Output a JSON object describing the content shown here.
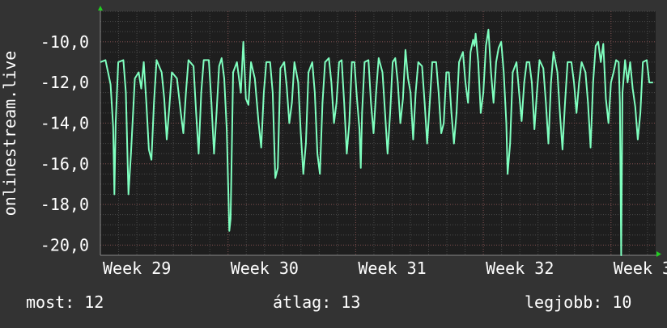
{
  "chart_data": {
    "type": "line",
    "ylabel": "onlinestream.live",
    "ylim": [
      -20.5,
      -8.5
    ],
    "yticks": [
      -10,
      -12,
      -14,
      -16,
      -18,
      -20
    ],
    "ytick_labels": [
      "-10,0",
      "-12,0",
      "-14,0",
      "-16,0",
      "-18,0",
      "-20,0"
    ],
    "xlim": [
      0,
      4.35
    ],
    "xticks": [
      0,
      1,
      2,
      3,
      4
    ],
    "xtick_labels": [
      "Week 29",
      "Week 30",
      "Week 31",
      "Week 32",
      "Week 3"
    ],
    "grid": true,
    "colors": {
      "background": "#333333",
      "plot": "#1e1e1e",
      "grid": "#5a5a5a",
      "line": "#7fffbf",
      "axis_arrow": "#22cc22",
      "text": "#ffffff"
    },
    "series": [
      {
        "values": [
          {
            "x": 0.0,
            "y": -11.0
          },
          {
            "x": 0.04,
            "y": -10.9
          },
          {
            "x": 0.06,
            "y": -11.5
          },
          {
            "x": 0.08,
            "y": -12.1
          },
          {
            "x": 0.1,
            "y": -14.2
          },
          {
            "x": 0.11,
            "y": -17.5
          },
          {
            "x": 0.12,
            "y": -14.0
          },
          {
            "x": 0.14,
            "y": -11.0
          },
          {
            "x": 0.18,
            "y": -10.9
          },
          {
            "x": 0.2,
            "y": -12.5
          },
          {
            "x": 0.22,
            "y": -17.5
          },
          {
            "x": 0.24,
            "y": -15.5
          },
          {
            "x": 0.27,
            "y": -11.8
          },
          {
            "x": 0.3,
            "y": -11.5
          },
          {
            "x": 0.32,
            "y": -12.3
          },
          {
            "x": 0.34,
            "y": -11.0
          },
          {
            "x": 0.36,
            "y": -13.0
          },
          {
            "x": 0.38,
            "y": -15.3
          },
          {
            "x": 0.4,
            "y": -15.8
          },
          {
            "x": 0.42,
            "y": -13.0
          },
          {
            "x": 0.44,
            "y": -10.9
          },
          {
            "x": 0.48,
            "y": -11.5
          },
          {
            "x": 0.5,
            "y": -12.8
          },
          {
            "x": 0.52,
            "y": -14.8
          },
          {
            "x": 0.54,
            "y": -13.2
          },
          {
            "x": 0.56,
            "y": -11.5
          },
          {
            "x": 0.6,
            "y": -11.8
          },
          {
            "x": 0.63,
            "y": -13.5
          },
          {
            "x": 0.65,
            "y": -14.5
          },
          {
            "x": 0.67,
            "y": -12.5
          },
          {
            "x": 0.69,
            "y": -10.9
          },
          {
            "x": 0.73,
            "y": -11.2
          },
          {
            "x": 0.75,
            "y": -13.5
          },
          {
            "x": 0.77,
            "y": -15.5
          },
          {
            "x": 0.79,
            "y": -12.5
          },
          {
            "x": 0.81,
            "y": -10.9
          },
          {
            "x": 0.85,
            "y": -10.9
          },
          {
            "x": 0.87,
            "y": -13.0
          },
          {
            "x": 0.89,
            "y": -15.5
          },
          {
            "x": 0.91,
            "y": -13.5
          },
          {
            "x": 0.93,
            "y": -11.2
          },
          {
            "x": 0.95,
            "y": -10.8
          },
          {
            "x": 0.97,
            "y": -11.8
          },
          {
            "x": 0.99,
            "y": -14.3
          },
          {
            "x": 1.01,
            "y": -19.3
          },
          {
            "x": 1.02,
            "y": -18.7
          },
          {
            "x": 1.04,
            "y": -11.5
          },
          {
            "x": 1.07,
            "y": -11.0
          },
          {
            "x": 1.1,
            "y": -12.5
          },
          {
            "x": 1.12,
            "y": -10.0
          },
          {
            "x": 1.14,
            "y": -12.8
          },
          {
            "x": 1.16,
            "y": -13.1
          },
          {
            "x": 1.18,
            "y": -11.0
          },
          {
            "x": 1.21,
            "y": -11.8
          },
          {
            "x": 1.24,
            "y": -14.0
          },
          {
            "x": 1.26,
            "y": -15.2
          },
          {
            "x": 1.28,
            "y": -12.5
          },
          {
            "x": 1.3,
            "y": -11.0
          },
          {
            "x": 1.33,
            "y": -11.0
          },
          {
            "x": 1.35,
            "y": -12.5
          },
          {
            "x": 1.37,
            "y": -16.7
          },
          {
            "x": 1.39,
            "y": -16.2
          },
          {
            "x": 1.41,
            "y": -11.3
          },
          {
            "x": 1.44,
            "y": -11.0
          },
          {
            "x": 1.46,
            "y": -12.2
          },
          {
            "x": 1.48,
            "y": -14.0
          },
          {
            "x": 1.5,
            "y": -13.0
          },
          {
            "x": 1.52,
            "y": -11.0
          },
          {
            "x": 1.55,
            "y": -12.0
          },
          {
            "x": 1.57,
            "y": -14.5
          },
          {
            "x": 1.59,
            "y": -16.5
          },
          {
            "x": 1.61,
            "y": -15.0
          },
          {
            "x": 1.63,
            "y": -11.5
          },
          {
            "x": 1.66,
            "y": -11.0
          },
          {
            "x": 1.68,
            "y": -12.5
          },
          {
            "x": 1.7,
            "y": -15.5
          },
          {
            "x": 1.72,
            "y": -16.5
          },
          {
            "x": 1.74,
            "y": -13.0
          },
          {
            "x": 1.76,
            "y": -11.0
          },
          {
            "x": 1.79,
            "y": -10.8
          },
          {
            "x": 1.81,
            "y": -12.0
          },
          {
            "x": 1.83,
            "y": -14.0
          },
          {
            "x": 1.85,
            "y": -13.0
          },
          {
            "x": 1.87,
            "y": -11.0
          },
          {
            "x": 1.89,
            "y": -10.9
          },
          {
            "x": 1.91,
            "y": -13.0
          },
          {
            "x": 1.93,
            "y": -15.5
          },
          {
            "x": 1.95,
            "y": -14.0
          },
          {
            "x": 1.97,
            "y": -11.0
          },
          {
            "x": 1.99,
            "y": -11.0
          },
          {
            "x": 2.01,
            "y": -12.8
          },
          {
            "x": 2.03,
            "y": -14.3
          },
          {
            "x": 2.04,
            "y": -16.2
          },
          {
            "x": 2.05,
            "y": -13.5
          },
          {
            "x": 2.07,
            "y": -11.0
          },
          {
            "x": 2.1,
            "y": -10.9
          },
          {
            "x": 2.12,
            "y": -13.0
          },
          {
            "x": 2.14,
            "y": -14.5
          },
          {
            "x": 2.16,
            "y": -12.5
          },
          {
            "x": 2.18,
            "y": -10.8
          },
          {
            "x": 2.21,
            "y": -11.5
          },
          {
            "x": 2.23,
            "y": -13.5
          },
          {
            "x": 2.25,
            "y": -15.5
          },
          {
            "x": 2.27,
            "y": -13.5
          },
          {
            "x": 2.29,
            "y": -11.0
          },
          {
            "x": 2.31,
            "y": -10.8
          },
          {
            "x": 2.33,
            "y": -12.0
          },
          {
            "x": 2.35,
            "y": -14.0
          },
          {
            "x": 2.37,
            "y": -12.8
          },
          {
            "x": 2.39,
            "y": -10.4
          },
          {
            "x": 2.41,
            "y": -11.8
          },
          {
            "x": 2.43,
            "y": -12.5
          },
          {
            "x": 2.45,
            "y": -14.8
          },
          {
            "x": 2.47,
            "y": -12.5
          },
          {
            "x": 2.49,
            "y": -11.0
          },
          {
            "x": 2.52,
            "y": -11.2
          },
          {
            "x": 2.54,
            "y": -13.0
          },
          {
            "x": 2.56,
            "y": -15.0
          },
          {
            "x": 2.58,
            "y": -13.0
          },
          {
            "x": 2.6,
            "y": -11.0
          },
          {
            "x": 2.63,
            "y": -11.0
          },
          {
            "x": 2.65,
            "y": -12.5
          },
          {
            "x": 2.67,
            "y": -14.5
          },
          {
            "x": 2.69,
            "y": -14.0
          },
          {
            "x": 2.71,
            "y": -11.5
          },
          {
            "x": 2.73,
            "y": -11.5
          },
          {
            "x": 2.75,
            "y": -13.5
          },
          {
            "x": 2.77,
            "y": -15.0
          },
          {
            "x": 2.79,
            "y": -13.5
          },
          {
            "x": 2.81,
            "y": -11.0
          },
          {
            "x": 2.84,
            "y": -10.5
          },
          {
            "x": 2.86,
            "y": -12.0
          },
          {
            "x": 2.88,
            "y": -13.0
          },
          {
            "x": 2.9,
            "y": -10.5
          },
          {
            "x": 2.92,
            "y": -9.9
          },
          {
            "x": 2.93,
            "y": -10.2
          },
          {
            "x": 2.94,
            "y": -9.6
          },
          {
            "x": 2.96,
            "y": -11.0
          },
          {
            "x": 2.98,
            "y": -13.5
          },
          {
            "x": 3.0,
            "y": -12.5
          },
          {
            "x": 3.02,
            "y": -10.2
          },
          {
            "x": 3.04,
            "y": -9.4
          },
          {
            "x": 3.06,
            "y": -11.5
          },
          {
            "x": 3.08,
            "y": -13.0
          },
          {
            "x": 3.1,
            "y": -11.0
          },
          {
            "x": 3.12,
            "y": -10.3
          },
          {
            "x": 3.14,
            "y": -10.0
          },
          {
            "x": 3.16,
            "y": -11.5
          },
          {
            "x": 3.18,
            "y": -14.0
          },
          {
            "x": 3.19,
            "y": -16.5
          },
          {
            "x": 3.21,
            "y": -15.0
          },
          {
            "x": 3.23,
            "y": -11.5
          },
          {
            "x": 3.26,
            "y": -11.0
          },
          {
            "x": 3.28,
            "y": -12.5
          },
          {
            "x": 3.3,
            "y": -13.9
          },
          {
            "x": 3.32,
            "y": -12.0
          },
          {
            "x": 3.34,
            "y": -11.0
          },
          {
            "x": 3.36,
            "y": -11.0
          },
          {
            "x": 3.38,
            "y": -12.0
          },
          {
            "x": 3.4,
            "y": -14.3
          },
          {
            "x": 3.42,
            "y": -12.5
          },
          {
            "x": 3.44,
            "y": -10.9
          },
          {
            "x": 3.47,
            "y": -11.3
          },
          {
            "x": 3.49,
            "y": -13.0
          },
          {
            "x": 3.51,
            "y": -15.0
          },
          {
            "x": 3.53,
            "y": -12.0
          },
          {
            "x": 3.55,
            "y": -10.5
          },
          {
            "x": 3.58,
            "y": -11.5
          },
          {
            "x": 3.6,
            "y": -13.5
          },
          {
            "x": 3.62,
            "y": -15.3
          },
          {
            "x": 3.64,
            "y": -13.0
          },
          {
            "x": 3.66,
            "y": -11.0
          },
          {
            "x": 3.69,
            "y": -11.0
          },
          {
            "x": 3.71,
            "y": -12.0
          },
          {
            "x": 3.73,
            "y": -13.5
          },
          {
            "x": 3.75,
            "y": -12.0
          },
          {
            "x": 3.77,
            "y": -11.0
          },
          {
            "x": 3.8,
            "y": -11.5
          },
          {
            "x": 3.82,
            "y": -13.0
          },
          {
            "x": 3.84,
            "y": -15.2
          },
          {
            "x": 3.86,
            "y": -12.0
          },
          {
            "x": 3.88,
            "y": -10.2
          },
          {
            "x": 3.9,
            "y": -10.0
          },
          {
            "x": 3.92,
            "y": -11.0
          },
          {
            "x": 3.94,
            "y": -10.1
          },
          {
            "x": 3.96,
            "y": -12.8
          },
          {
            "x": 3.98,
            "y": -14.0
          },
          {
            "x": 4.0,
            "y": -12.0
          },
          {
            "x": 4.02,
            "y": -11.5
          },
          {
            "x": 4.04,
            "y": -10.9
          },
          {
            "x": 4.06,
            "y": -11.0
          },
          {
            "x": 4.07,
            "y": -13.0
          },
          {
            "x": 4.08,
            "y": -20.5
          },
          {
            "x": 4.09,
            "y": -12.5
          },
          {
            "x": 4.11,
            "y": -10.9
          },
          {
            "x": 4.13,
            "y": -12.0
          },
          {
            "x": 4.15,
            "y": -11.0
          },
          {
            "x": 4.17,
            "y": -12.3
          },
          {
            "x": 4.19,
            "y": -13.2
          },
          {
            "x": 4.21,
            "y": -14.8
          },
          {
            "x": 4.23,
            "y": -13.5
          },
          {
            "x": 4.25,
            "y": -11.0
          },
          {
            "x": 4.28,
            "y": -10.9
          },
          {
            "x": 4.3,
            "y": -12.0
          },
          {
            "x": 4.33,
            "y": -12.0
          }
        ]
      }
    ]
  },
  "stats": {
    "current": "most: 12",
    "average": "átlag: 13",
    "best": "legjobb: 10"
  }
}
